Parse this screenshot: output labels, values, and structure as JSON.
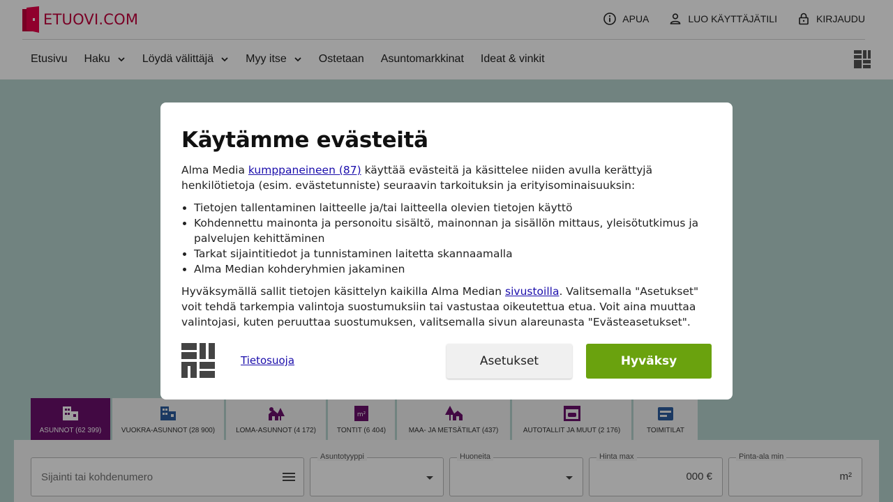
{
  "brand": {
    "logo_text": "ETUOVI.COM"
  },
  "top_actions": [
    {
      "label": "APUA",
      "icon": "info-icon"
    },
    {
      "label": "LUO KÄYTTÄJÄTILI",
      "icon": "user-icon"
    },
    {
      "label": "KIRJAUDU",
      "icon": "lock-icon"
    }
  ],
  "nav": [
    {
      "label": "Etusivu",
      "dropdown": false
    },
    {
      "label": "Haku",
      "dropdown": true
    },
    {
      "label": "Löydä välittäjä",
      "dropdown": true
    },
    {
      "label": "Myy itse",
      "dropdown": true
    },
    {
      "label": "Ostetaan",
      "dropdown": false
    },
    {
      "label": "Asuntomarkkinat",
      "dropdown": false
    },
    {
      "label": "Ideat & vinkit",
      "dropdown": false
    }
  ],
  "tabs": [
    {
      "label": "ASUNNOT (62 399)",
      "icon": "apartment-icon",
      "active": true
    },
    {
      "label": "VUOKRA-ASUNNOT (28 900)",
      "icon": "rental-icon",
      "active": false
    },
    {
      "label": "LOMA-ASUNNOT (4 172)",
      "icon": "cottage-icon",
      "active": false
    },
    {
      "label": "TONTIT (6 404)",
      "icon": "plot-icon",
      "active": false
    },
    {
      "label": "MAA- JA METSÄTILAT (437)",
      "icon": "forest-icon",
      "active": false
    },
    {
      "label": "AUTOTALLIT JA MUUT (2 176)",
      "icon": "garage-icon",
      "active": false
    },
    {
      "label": "TOIMITILAT",
      "icon": "office-icon",
      "active": false
    }
  ],
  "search": {
    "location_placeholder": "Sijainti tai kohdenumero",
    "type_label": "Asuntotyyppi",
    "rooms_label": "Huoneita",
    "price_label": "Hinta max",
    "price_suffix": "000 €",
    "area_label": "Pinta-ala min",
    "area_suffix": "m²"
  },
  "consent": {
    "title": "Käytämme evästeitä",
    "intro_before": "Alma Media ",
    "partners_link": "kumppaneineen (87)",
    "intro_after": " käyttää evästeitä ja käsittelee niiden avulla kerättyjä henkilötietoja (esim. evästetunniste) seuraavin tarkoituksin ja erityisominaisuuksin:",
    "purposes": [
      "Tietojen tallentaminen laitteelle ja/tai laitteella olevien tietojen käyttö",
      "Kohdennettu mainonta ja personoitu sisältö, mainonnan ja sisällön mittaus, yleisötutkimus ja palvelujen kehittäminen",
      "Tarkat sijaintitiedot ja tunnistaminen laitetta skannaamalla",
      "Alma Median kohderyhmien jakaminen"
    ],
    "outro_before": "Hyväksymällä sallit tietojen käsittelyn kaikilla Alma Median ",
    "sites_link": "sivustoilla",
    "outro_after": ". Valitsemalla \"Asetukset\" voit tehdä tarkempia valintoja suostumuksiin tai vastustaa oikeutettua etua. Voit aina muuttaa valintojasi, kuten peruuttaa suostumuksen, valitsemalla sivun alareunasta \"Evästeasetukset\".",
    "privacy_link": "Tietosuoja",
    "settings_button": "Asetukset",
    "accept_button": "Hyväksy"
  },
  "colors": {
    "brand": "#c4003d",
    "accent": "#6aa20e",
    "active_tab": "#6b0f6d",
    "hero": "#b7d3cf"
  }
}
